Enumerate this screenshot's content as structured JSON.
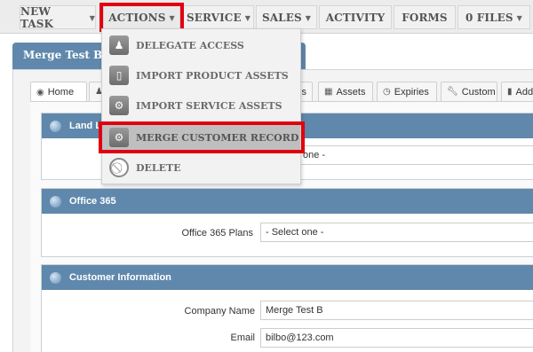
{
  "nav": {
    "new_task": "NEW TASK",
    "actions": "ACTIONS",
    "service": "SERVICE",
    "sales": "SALES",
    "activity": "ACTIVITY",
    "forms": "FORMS",
    "files": "0 FILES"
  },
  "page": {
    "title": "Merge Test B"
  },
  "subtabs": [
    "Home",
    "es",
    "Assets",
    "Expiries",
    "Custom",
    "Addr"
  ],
  "dropdown": {
    "items": [
      {
        "label": "DELEGATE ACCESS",
        "icon": "person-icon"
      },
      {
        "label": "IMPORT PRODUCT ASSETS",
        "icon": "phone-icon"
      },
      {
        "label": "IMPORT SERVICE ASSETS",
        "icon": "gear-icon"
      },
      {
        "label": "MERGE CUSTOMER RECORD",
        "icon": "gear-icon"
      },
      {
        "label": "DELETE",
        "icon": "no-entry-icon"
      }
    ]
  },
  "sections": {
    "land": {
      "title": "Land L",
      "select_value": "one -"
    },
    "office": {
      "title": "Office 365",
      "label": "Office 365 Plans",
      "select_value": "- Select one -"
    },
    "customer": {
      "title": "Customer Information",
      "company_label": "Company Name",
      "company_value": "Merge Test B",
      "email_label": "Email",
      "email_value": "bilbo@123.com"
    }
  },
  "colors": {
    "accent": "#5f88ac",
    "highlight": "#e1000f"
  }
}
